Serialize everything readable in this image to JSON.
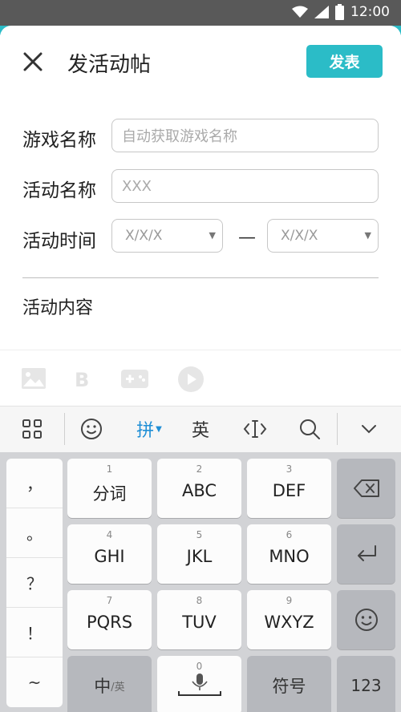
{
  "status_bar": {
    "time": "12:00"
  },
  "header": {
    "title": "发活动帖",
    "publish_label": "发表"
  },
  "form": {
    "game_name": {
      "label": "游戏名称",
      "placeholder": "自动获取游戏名称"
    },
    "activity_name": {
      "label": "活动名称",
      "placeholder": "XXX"
    },
    "activity_time": {
      "label": "活动时间",
      "start": "X/X/X",
      "separator": "—",
      "end": "X/X/X"
    },
    "content_label": "活动内容"
  },
  "editor_toolbar": {
    "items": [
      "image-icon",
      "bold-icon",
      "gamepad-icon",
      "play-icon"
    ]
  },
  "keyboard": {
    "topbar": {
      "pinyin": "拼",
      "english": "英"
    },
    "punctuation": [
      "，",
      "。",
      "？",
      "！",
      "~"
    ],
    "keys": [
      {
        "num": "1",
        "label": "分词"
      },
      {
        "num": "2",
        "label": "ABC"
      },
      {
        "num": "3",
        "label": "DEF"
      },
      {
        "num": "4",
        "label": "GHI"
      },
      {
        "num": "5",
        "label": "JKL"
      },
      {
        "num": "6",
        "label": "MNO"
      },
      {
        "num": "7",
        "label": "PQRS"
      },
      {
        "num": "8",
        "label": "TUV"
      },
      {
        "num": "9",
        "label": "WXYZ"
      }
    ],
    "bottom": {
      "zh": "中",
      "en_sub": "/英",
      "space_num": "0",
      "symbols": "符号",
      "num_mode": "123"
    }
  },
  "colors": {
    "accent": "#2bbcc7",
    "status_bar": "#595959",
    "keyboard_bg": "#d2d3d6"
  }
}
